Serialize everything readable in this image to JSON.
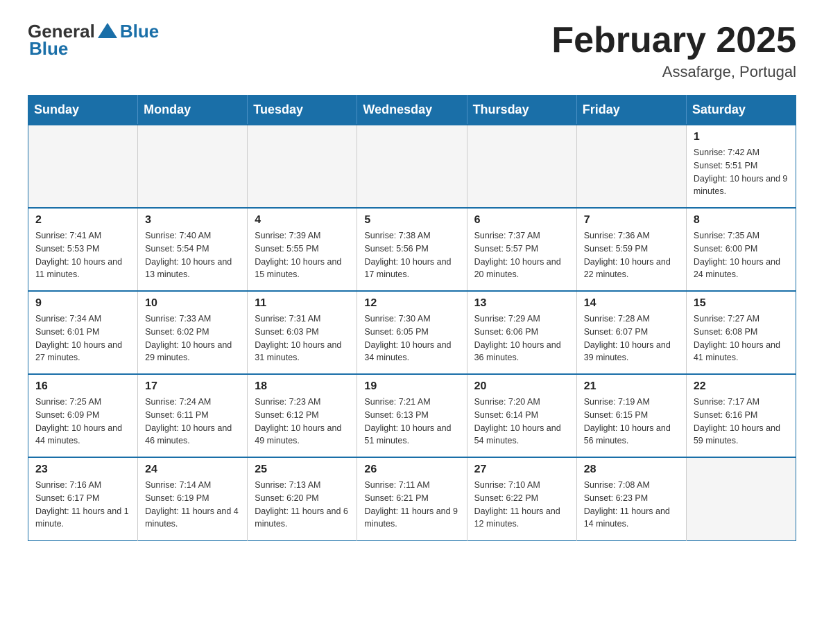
{
  "header": {
    "logo": {
      "general": "General",
      "blue": "Blue"
    },
    "title": "February 2025",
    "location": "Assafarge, Portugal"
  },
  "days_of_week": [
    "Sunday",
    "Monday",
    "Tuesday",
    "Wednesday",
    "Thursday",
    "Friday",
    "Saturday"
  ],
  "weeks": [
    [
      {
        "day": "",
        "sunrise": "",
        "sunset": "",
        "daylight": "",
        "empty": true
      },
      {
        "day": "",
        "sunrise": "",
        "sunset": "",
        "daylight": "",
        "empty": true
      },
      {
        "day": "",
        "sunrise": "",
        "sunset": "",
        "daylight": "",
        "empty": true
      },
      {
        "day": "",
        "sunrise": "",
        "sunset": "",
        "daylight": "",
        "empty": true
      },
      {
        "day": "",
        "sunrise": "",
        "sunset": "",
        "daylight": "",
        "empty": true
      },
      {
        "day": "",
        "sunrise": "",
        "sunset": "",
        "daylight": "",
        "empty": true
      },
      {
        "day": "1",
        "sunrise": "Sunrise: 7:42 AM",
        "sunset": "Sunset: 5:51 PM",
        "daylight": "Daylight: 10 hours and 9 minutes.",
        "empty": false
      }
    ],
    [
      {
        "day": "2",
        "sunrise": "Sunrise: 7:41 AM",
        "sunset": "Sunset: 5:53 PM",
        "daylight": "Daylight: 10 hours and 11 minutes.",
        "empty": false
      },
      {
        "day": "3",
        "sunrise": "Sunrise: 7:40 AM",
        "sunset": "Sunset: 5:54 PM",
        "daylight": "Daylight: 10 hours and 13 minutes.",
        "empty": false
      },
      {
        "day": "4",
        "sunrise": "Sunrise: 7:39 AM",
        "sunset": "Sunset: 5:55 PM",
        "daylight": "Daylight: 10 hours and 15 minutes.",
        "empty": false
      },
      {
        "day": "5",
        "sunrise": "Sunrise: 7:38 AM",
        "sunset": "Sunset: 5:56 PM",
        "daylight": "Daylight: 10 hours and 17 minutes.",
        "empty": false
      },
      {
        "day": "6",
        "sunrise": "Sunrise: 7:37 AM",
        "sunset": "Sunset: 5:57 PM",
        "daylight": "Daylight: 10 hours and 20 minutes.",
        "empty": false
      },
      {
        "day": "7",
        "sunrise": "Sunrise: 7:36 AM",
        "sunset": "Sunset: 5:59 PM",
        "daylight": "Daylight: 10 hours and 22 minutes.",
        "empty": false
      },
      {
        "day": "8",
        "sunrise": "Sunrise: 7:35 AM",
        "sunset": "Sunset: 6:00 PM",
        "daylight": "Daylight: 10 hours and 24 minutes.",
        "empty": false
      }
    ],
    [
      {
        "day": "9",
        "sunrise": "Sunrise: 7:34 AM",
        "sunset": "Sunset: 6:01 PM",
        "daylight": "Daylight: 10 hours and 27 minutes.",
        "empty": false
      },
      {
        "day": "10",
        "sunrise": "Sunrise: 7:33 AM",
        "sunset": "Sunset: 6:02 PM",
        "daylight": "Daylight: 10 hours and 29 minutes.",
        "empty": false
      },
      {
        "day": "11",
        "sunrise": "Sunrise: 7:31 AM",
        "sunset": "Sunset: 6:03 PM",
        "daylight": "Daylight: 10 hours and 31 minutes.",
        "empty": false
      },
      {
        "day": "12",
        "sunrise": "Sunrise: 7:30 AM",
        "sunset": "Sunset: 6:05 PM",
        "daylight": "Daylight: 10 hours and 34 minutes.",
        "empty": false
      },
      {
        "day": "13",
        "sunrise": "Sunrise: 7:29 AM",
        "sunset": "Sunset: 6:06 PM",
        "daylight": "Daylight: 10 hours and 36 minutes.",
        "empty": false
      },
      {
        "day": "14",
        "sunrise": "Sunrise: 7:28 AM",
        "sunset": "Sunset: 6:07 PM",
        "daylight": "Daylight: 10 hours and 39 minutes.",
        "empty": false
      },
      {
        "day": "15",
        "sunrise": "Sunrise: 7:27 AM",
        "sunset": "Sunset: 6:08 PM",
        "daylight": "Daylight: 10 hours and 41 minutes.",
        "empty": false
      }
    ],
    [
      {
        "day": "16",
        "sunrise": "Sunrise: 7:25 AM",
        "sunset": "Sunset: 6:09 PM",
        "daylight": "Daylight: 10 hours and 44 minutes.",
        "empty": false
      },
      {
        "day": "17",
        "sunrise": "Sunrise: 7:24 AM",
        "sunset": "Sunset: 6:11 PM",
        "daylight": "Daylight: 10 hours and 46 minutes.",
        "empty": false
      },
      {
        "day": "18",
        "sunrise": "Sunrise: 7:23 AM",
        "sunset": "Sunset: 6:12 PM",
        "daylight": "Daylight: 10 hours and 49 minutes.",
        "empty": false
      },
      {
        "day": "19",
        "sunrise": "Sunrise: 7:21 AM",
        "sunset": "Sunset: 6:13 PM",
        "daylight": "Daylight: 10 hours and 51 minutes.",
        "empty": false
      },
      {
        "day": "20",
        "sunrise": "Sunrise: 7:20 AM",
        "sunset": "Sunset: 6:14 PM",
        "daylight": "Daylight: 10 hours and 54 minutes.",
        "empty": false
      },
      {
        "day": "21",
        "sunrise": "Sunrise: 7:19 AM",
        "sunset": "Sunset: 6:15 PM",
        "daylight": "Daylight: 10 hours and 56 minutes.",
        "empty": false
      },
      {
        "day": "22",
        "sunrise": "Sunrise: 7:17 AM",
        "sunset": "Sunset: 6:16 PM",
        "daylight": "Daylight: 10 hours and 59 minutes.",
        "empty": false
      }
    ],
    [
      {
        "day": "23",
        "sunrise": "Sunrise: 7:16 AM",
        "sunset": "Sunset: 6:17 PM",
        "daylight": "Daylight: 11 hours and 1 minute.",
        "empty": false
      },
      {
        "day": "24",
        "sunrise": "Sunrise: 7:14 AM",
        "sunset": "Sunset: 6:19 PM",
        "daylight": "Daylight: 11 hours and 4 minutes.",
        "empty": false
      },
      {
        "day": "25",
        "sunrise": "Sunrise: 7:13 AM",
        "sunset": "Sunset: 6:20 PM",
        "daylight": "Daylight: 11 hours and 6 minutes.",
        "empty": false
      },
      {
        "day": "26",
        "sunrise": "Sunrise: 7:11 AM",
        "sunset": "Sunset: 6:21 PM",
        "daylight": "Daylight: 11 hours and 9 minutes.",
        "empty": false
      },
      {
        "day": "27",
        "sunrise": "Sunrise: 7:10 AM",
        "sunset": "Sunset: 6:22 PM",
        "daylight": "Daylight: 11 hours and 12 minutes.",
        "empty": false
      },
      {
        "day": "28",
        "sunrise": "Sunrise: 7:08 AM",
        "sunset": "Sunset: 6:23 PM",
        "daylight": "Daylight: 11 hours and 14 minutes.",
        "empty": false
      },
      {
        "day": "",
        "sunrise": "",
        "sunset": "",
        "daylight": "",
        "empty": true
      }
    ]
  ]
}
